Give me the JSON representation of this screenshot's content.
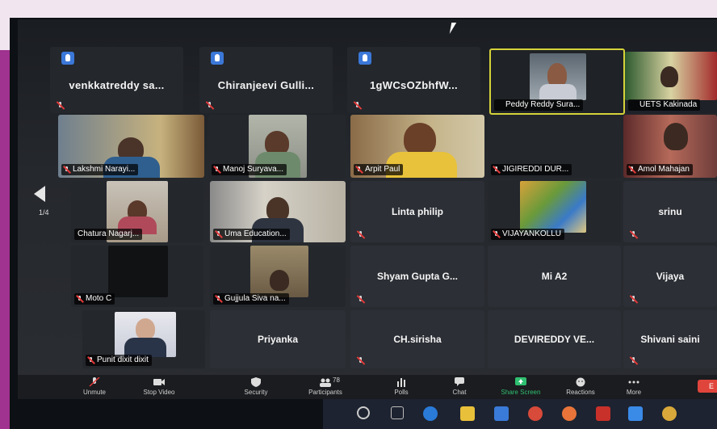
{
  "meeting": {
    "page_indicator": "1/4",
    "top_row": [
      {
        "name": "venkkatreddy sa..."
      },
      {
        "name": "Chiranjeevi Gulli..."
      },
      {
        "name": "1gWCsOZbhfW..."
      },
      {
        "name": "Peddy Reddy Sura..."
      },
      {
        "name": "UETS Kakinada"
      }
    ],
    "row2": [
      {
        "name": "Lakshmi Narayi..."
      },
      {
        "name": "Manoj Suryava..."
      },
      {
        "name": "Arpit Paul"
      },
      {
        "name": "JIGIREDDI DUR..."
      },
      {
        "name": "Amol Mahajan"
      }
    ],
    "row3": [
      {
        "name": "Chatura Nagarj..."
      },
      {
        "name": "Uma Education..."
      },
      {
        "name": "Linta philip"
      },
      {
        "name": "VIJAYANKOLLU"
      },
      {
        "name": "srinu"
      }
    ],
    "row4": [
      {
        "name": "Moto C"
      },
      {
        "name": "Gujjula Siva na..."
      },
      {
        "name": "Shyam Gupta G..."
      },
      {
        "name": "Mi A2"
      },
      {
        "name": "Vijaya"
      }
    ],
    "row5": [
      {
        "name": "Punit dixit dixit"
      },
      {
        "name": "Priyanka"
      },
      {
        "name": "CH.sirisha"
      },
      {
        "name": "DEVIREDDY VE..."
      },
      {
        "name": "Shivani saini"
      }
    ]
  },
  "toolbar": {
    "unmute": "Unmute",
    "stop_video": "Stop Video",
    "security": "Security",
    "participants": "Participants",
    "participants_count": "78",
    "polls": "Polls",
    "chat": "Chat",
    "share_screen": "Share Screen",
    "reactions": "Reactions",
    "more": "More",
    "end": "E"
  },
  "colors": {
    "active_speaker_border": "#d6d23a",
    "share_screen_green": "#2fbf71",
    "end_red": "#e0453c",
    "frame_accent": "#a0338f"
  }
}
